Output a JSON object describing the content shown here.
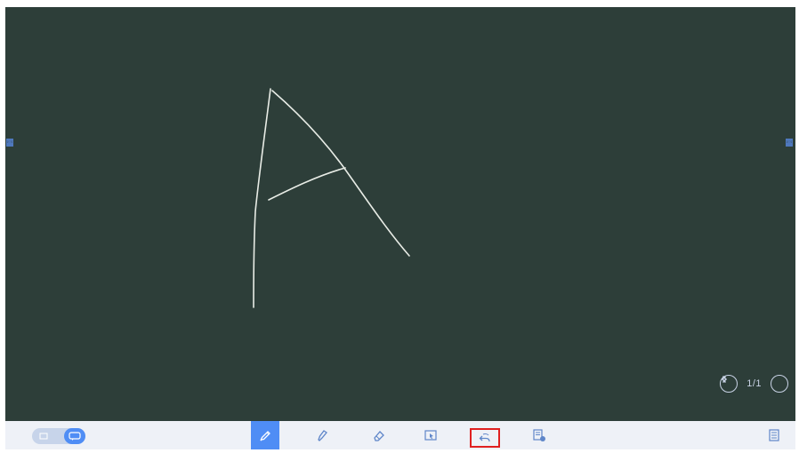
{
  "pagination": {
    "page_indicator": "1/1"
  },
  "toolbar": {
    "tools": [
      {
        "name": "pen",
        "icon": "pen-icon",
        "active": true
      },
      {
        "name": "brush",
        "icon": "brush-icon",
        "active": false
      },
      {
        "name": "eraser",
        "icon": "eraser-icon",
        "active": false
      },
      {
        "name": "select",
        "icon": "select-icon",
        "active": false
      },
      {
        "name": "undo",
        "icon": "undo-icon",
        "active": false,
        "highlighted": true
      },
      {
        "name": "more",
        "icon": "more-icon",
        "active": false
      }
    ],
    "mode_toggle": {
      "state": "on"
    }
  },
  "colors": {
    "board": "#2d3e39",
    "ink": "#e8ece6",
    "accent": "#4f8df5",
    "toolbar_bg": "#eef1f7",
    "icon": "#5f86c9",
    "highlight_box": "#e02020"
  }
}
